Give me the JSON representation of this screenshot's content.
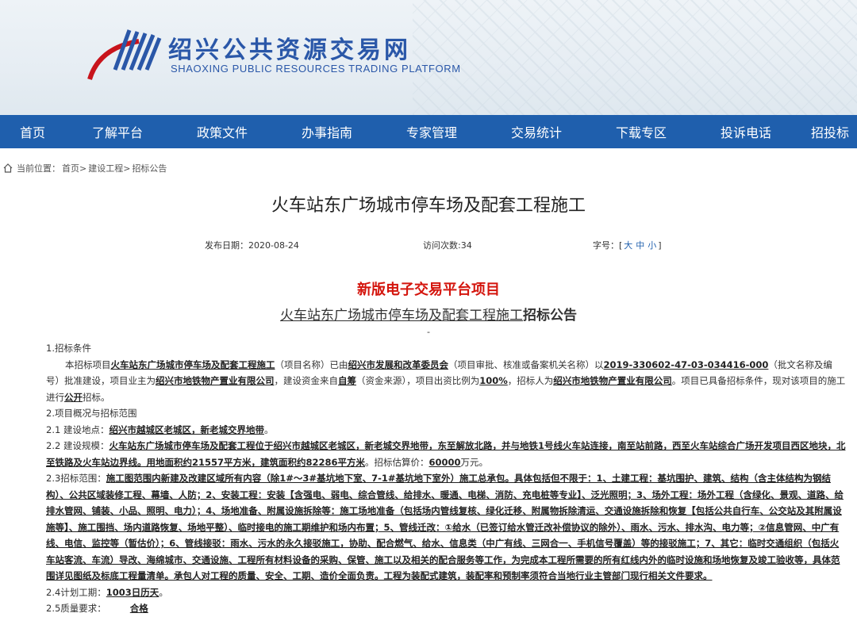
{
  "header": {
    "site_name_cn": "绍兴公共资源交易网",
    "site_name_en": "SHAOXING PUBLIC RESOURCES TRADING PLATFORM",
    "brand_color": "#2a57a8"
  },
  "nav": {
    "items": [
      "首页",
      "了解平台",
      "政策文件",
      "办事指南",
      "专家管理",
      "交易统计",
      "下载专区",
      "投诉电话",
      "招投标"
    ],
    "color": "#1f5fad"
  },
  "breadcrumb": {
    "prefix": "当前位置：",
    "items": [
      "首页>",
      "建设工程>",
      "招标公告"
    ]
  },
  "article": {
    "title": "火车站东广场城市停车场及配套工程施工",
    "publish_date": "发布日期：2020-08-24",
    "visits": "访问次数:34",
    "font_size_label": "字号：[",
    "font_sizes": [
      "大",
      "中",
      "小"
    ],
    "font_size_end": "]"
  },
  "notice": {
    "red_title": "新版电子交易平台项目",
    "sub_title_link": "火车站东广场城市停车场及配套工程施工",
    "sub_title_suffix": "招标公告",
    "dash": "-",
    "s1_heading": "1.招标条件",
    "s1_a": "本招标项目",
    "s1_project": "火车站东广场城市停车场及配套工程施工",
    "s1_b": "（项目名称）已由",
    "s1_approver": "绍兴市发展和改革委员会",
    "s1_c": "（项目审批、核准或备案机关名称）以",
    "s1_code": "2019-330602-47-03-034416-000",
    "s1_d": "（批文名称及编号）批准建设，项目业主为",
    "s1_owner": "绍兴市地铁物产置业有限公司",
    "s1_e": "，建设资金来自",
    "s1_fund": "自筹",
    "s1_f": "（资金来源），项目出资比例为",
    "s1_ratio": "100%",
    "s1_g": "，招标人为",
    "s1_tenderer": "绍兴市地铁物产置业有限公司",
    "s1_h": "。项目已具备招标条件，现对该项目的施工进行",
    "s1_open": "公开",
    "s1_i": "招标。",
    "s2_heading": "2.项目概况与招标范围",
    "s21_label": "2.1 建设地点：",
    "s21_value": "绍兴市越城区老城区，新老城交界地带",
    "s21_end": "。",
    "s22_label": "2.2 建设规模：",
    "s22_value": "火车站东广场城市停车场及配套工程位于绍兴市越城区老城区，新老城交界地带，东至解放北路，并与地铁1号线火车站连接，南至站前路，西至火车站综合广场开发项目西区地块，北至铁路及火车站边界线。用地面积约21557平方米，建筑面积约82286平方米",
    "s22_mid": "。招标估算价：",
    "s22_price": "60000",
    "s22_unit": "万元。",
    "s23_label": "2.3招标范围：",
    "s23_value": "施工图范围内新建及改建区域所有内容（除1#～3#基坑地下室、7-1#基坑地下室外）施工总承包。具体包括但不限于：1、土建工程：基坑围护、建筑、结构（含主体结构为钢结构）、公共区域装修工程、幕墙、人防；2、安装工程：安装【含强电、弱电、综合管线、给排水、暖通、电梯、消防、充电桩等专业】、泛光照明；3、场外工程：场外工程（含绿化、景观、道路、给排水管网、铺装、小品、照明、电力）；4、场地准备、附属设施拆除等：施工场地准备（包括场内管线复核、绿化迁移、附属物拆除清运、交通设施拆除和恢复【包括公共自行车、公交站及其附属设施等】、施工围挡、场内道路恢复、场地平整）、临时接电的施工期维护和场内布置；5、管线迁改：①给水（已签订给水管迁改补偿协议的除外）、雨水、污水、排水沟、电力等；②信息管网、中广有线、电信、监控等（暂估价）；6、管线接驳：雨水、污水的永久接驳施工，协助、配合燃气、给水、信息类（中广有线、三网合一、手机信号覆盖）等的接驳施工；7、其它：临时交通组织（包括火车站客流、车流）导改、海绵城市、交通设施、工程所有材料设备的采购、保管、施工以及相关的配合服务等工作，为完成本工程所需要的所有红线内外的临时设施和场地恢复及竣工验收等，具体范围详见图纸及标底工程量清单。承包人对工程的质量、安全、工期、造价全面负责。工程为装配式建筑，装配率和预制率须符合当地行业主管部门现行相关文件要求。",
    "s24_label": "2.4计划工期：",
    "s24_value": "1003日历天",
    "s24_end": "。",
    "s25_label": "2.5质量要求：",
    "s25_value": "合格"
  }
}
